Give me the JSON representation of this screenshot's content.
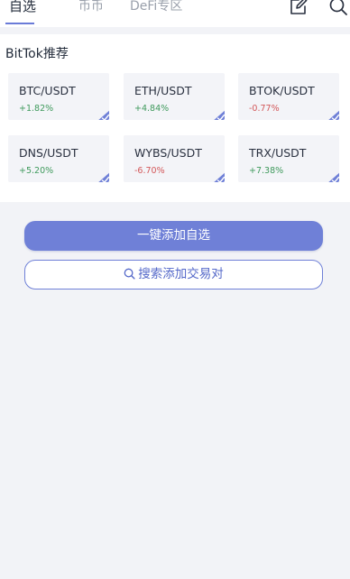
{
  "tabs": [
    {
      "label": "自选",
      "active": true
    },
    {
      "label": "币币",
      "active": false
    },
    {
      "label": "DeFi专区",
      "active": false
    }
  ],
  "header_icons": [
    "edit-icon",
    "search-icon"
  ],
  "recommend": {
    "title": "BitTok推荐",
    "cards": [
      {
        "pair": "BTC/USDT",
        "change": "+1.82%",
        "direction": "up"
      },
      {
        "pair": "ETH/USDT",
        "change": "+4.84%",
        "direction": "up"
      },
      {
        "pair": "BTOK/USDT",
        "change": "-0.77%",
        "direction": "down"
      },
      {
        "pair": "DNS/USDT",
        "change": "+5.20%",
        "direction": "up"
      },
      {
        "pair": "WYBS/USDT",
        "change": "-6.70%",
        "direction": "down"
      },
      {
        "pair": "TRX/USDT",
        "change": "+7.38%",
        "direction": "up"
      }
    ]
  },
  "buttons": {
    "add_all": "一键添加自选",
    "search_add": "搜索添加交易对"
  },
  "colors": {
    "accent": "#6f80d7",
    "up": "#3f9a5c",
    "down": "#d3585a",
    "background": "#f2f3f7"
  }
}
